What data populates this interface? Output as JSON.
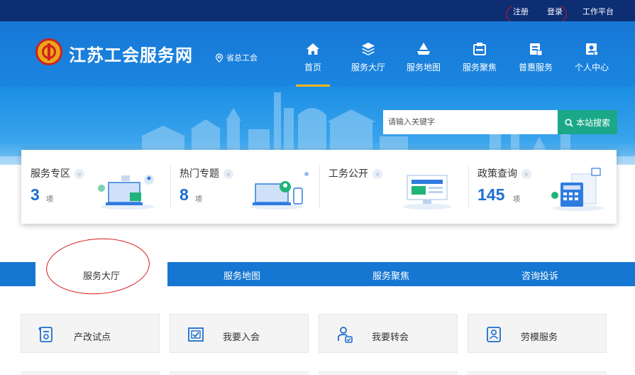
{
  "topbar": {
    "register": "注册",
    "login": "登录",
    "workbench": "工作平台"
  },
  "header": {
    "site_title": "江苏工会服务网",
    "region": "省总工会"
  },
  "nav": [
    {
      "label": "首页",
      "icon": "home-icon"
    },
    {
      "label": "服务大厅",
      "icon": "layers-icon"
    },
    {
      "label": "服务地图",
      "icon": "map-icon"
    },
    {
      "label": "服务聚焦",
      "icon": "focus-icon"
    },
    {
      "label": "普惠服务",
      "icon": "benefit-icon"
    },
    {
      "label": "个人中心",
      "icon": "person-icon"
    }
  ],
  "search": {
    "placeholder": "请输入关键字",
    "button": "本站搜索"
  },
  "cards": [
    {
      "title": "服务专区",
      "count": "3",
      "unit": "项"
    },
    {
      "title": "热门专题",
      "count": "8",
      "unit": "项"
    },
    {
      "title": "工务公开",
      "count": "",
      "unit": ""
    },
    {
      "title": "政策查询",
      "count": "145",
      "unit": "项"
    }
  ],
  "tabs": [
    "服务大厅",
    "服务地图",
    "服务聚焦",
    "咨询投诉"
  ],
  "services": [
    {
      "label": "产改试点",
      "icon": "certificate-icon"
    },
    {
      "label": "我要入会",
      "icon": "checklist-icon"
    },
    {
      "label": "我要转会",
      "icon": "transfer-user-icon"
    },
    {
      "label": "劳模服务",
      "icon": "badge-person-icon"
    }
  ],
  "colors": {
    "topbar": "#0d2e73",
    "header": "#1877d6",
    "tab_strip": "#1677d2",
    "search_button": "#1aa889",
    "nav_active_underline": "#f3b51c",
    "annotation_circle": "#d8141a"
  }
}
